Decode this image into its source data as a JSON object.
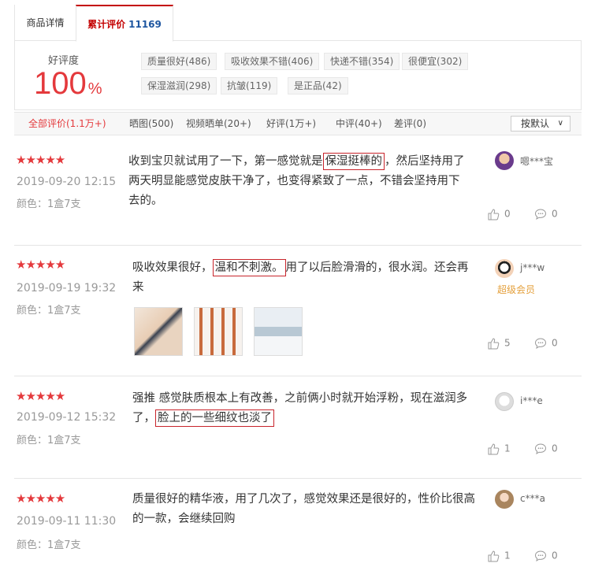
{
  "tabs": {
    "detail": "商品详情",
    "reviews": "累计评价",
    "review_count": "11169"
  },
  "rating": {
    "label": "好评度",
    "value": "100",
    "unit": "%"
  },
  "tags": [
    "质量很好(486)",
    "吸收效果不错(406)",
    "快递不错(354)",
    "很便宜(302)",
    "保湿滋润(298)",
    "抗皱(119)",
    "是正品(42)"
  ],
  "filters": [
    "全部评价(1.1万+)",
    "晒图(500)",
    "视频晒单(20+)",
    "好评(1万+)",
    "中评(40+)",
    "差评(0)"
  ],
  "sort": {
    "label": "按默认",
    "chevron": "∨"
  },
  "colors": {
    "accent": "#e4393c",
    "highlight_box": "#c8242b",
    "link_blue": "#1e56a0",
    "badge": "#e4a03c"
  },
  "reviews": [
    {
      "stars": "★★★★★",
      "date": "2019-09-20 12:15",
      "variant": "颜色：1盒7支",
      "text_a": "收到宝贝就试用了一下，第一感觉就是",
      "text_hl": "保湿挺棒的",
      "text_b": "，然后坚持用了两天明显能感觉皮肤干净了，也变得紧致了一点，不错会坚持用下去的。",
      "user": "嗯***宝",
      "likes": "0",
      "comments": "0"
    },
    {
      "stars": "★★★★★",
      "date": "2019-09-19 19:32",
      "variant": "颜色：1盒7支",
      "text_a": "吸收效果很好，",
      "text_hl": "温和不刺激。",
      "text_b": "用了以后脸滑滑的，很水润。还会再来",
      "user": "j***w",
      "badge": "超级会员",
      "likes": "5",
      "comments": "0"
    },
    {
      "stars": "★★★★★",
      "date": "2019-09-12 15:32",
      "variant": "颜色：1盒7支",
      "text_a": "强推 感觉肤质根本上有改善，之前俩小时就开始浮粉，现在滋润多了，",
      "text_hl": "脸上的一些细纹也淡了",
      "text_b": "",
      "user": "i***e",
      "likes": "1",
      "comments": "0"
    },
    {
      "stars": "★★★★★",
      "date": "2019-09-11 11:30",
      "variant": "颜色：1盒7支",
      "text_a": "质量很好的精华液，用了几次了，感觉效果还是很好的，性价比很高的一款，会继续回购",
      "text_hl": "",
      "text_b": "",
      "user": "c***a",
      "likes": "1",
      "comments": "0"
    }
  ]
}
